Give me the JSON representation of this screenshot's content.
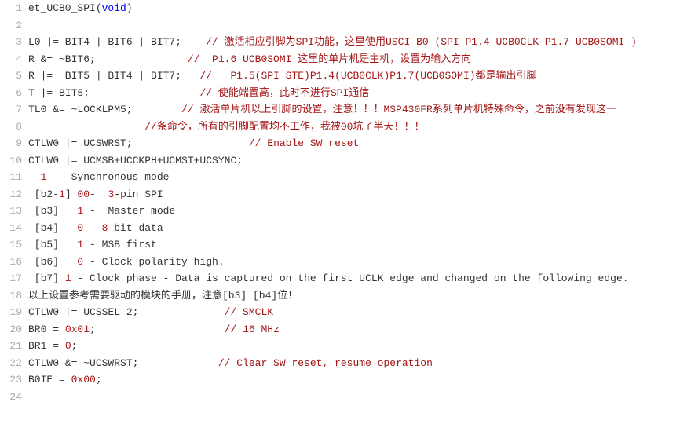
{
  "code": {
    "lines": [
      {
        "n": "1",
        "html": "et_UCB0_SPI(<span class='kw'>void</span>)"
      },
      {
        "n": "2",
        "html": ""
      },
      {
        "n": "3",
        "html": "L0 |= BIT4 | BIT6 | BIT7;    <span class='cm'>// 激活相应引脚为SPI功能，这里使用USCI_B0 (SPI P1.4 UCB0CLK P1.7 UCB0SOMI )</span>"
      },
      {
        "n": "4",
        "html": "R &amp;= ~BIT6;               <span class='cm'>//  P1.6 UCB0SOMI 这里的单片机是主机，设置为输入方向</span>"
      },
      {
        "n": "5",
        "html": "R |=  BIT5 | BIT4 | BIT7;   <span class='cm'>//   P1.5(SPI STE)P1.4(UCB0CLK)P1.7(UCB0SOMI)都是输出引脚</span>"
      },
      {
        "n": "6",
        "html": "T |= BIT5;                  <span class='cm'>// 使能端置高，此时不进行SPI通信</span>"
      },
      {
        "n": "7",
        "html": "TL0 &amp;= ~LOCKLPM5;        <span class='cm'>// 激活单片机以上引脚的设置，注意！！！MSP430FR系列单片机特殊命令，之前没有发现这一</span>"
      },
      {
        "n": "8",
        "html": "                   <span class='cm'>//条命令，所有的引脚配置均不工作，我被00坑了半天！！！</span>"
      },
      {
        "n": "9",
        "html": "CTLW0 |= UCSWRST;                   <span class='cm'>// Enable SW reset</span>"
      },
      {
        "n": "10",
        "html": "CTLW0 |= UCMSB+UCCKPH+UCMST+UCSYNC;"
      },
      {
        "n": "11",
        "html": "  <span class='num-red'>1</span> -  Synchronous mode"
      },
      {
        "n": "12",
        "html": " [b2-<span class='num-red'>1</span>] <span class='num-red'>00</span>-  <span class='num-red'>3</span>-pin SPI"
      },
      {
        "n": "13",
        "html": " [b3]   <span class='num-red'>1</span> -  Master mode"
      },
      {
        "n": "14",
        "html": " [b4]   <span class='num-red'>0</span> - <span class='num-red'>8</span>-bit data"
      },
      {
        "n": "15",
        "html": " [b5]   <span class='num-red'>1</span> - MSB first"
      },
      {
        "n": "16",
        "html": " [b6]   <span class='num-red'>0</span> - Clock polarity high."
      },
      {
        "n": "17",
        "html": " [b7] <span class='num-red'>1</span> - Clock phase - Data is captured on the first UCLK edge and changed on the following edge."
      },
      {
        "n": "18",
        "html": "以上设置参考需要驱动的模块的手册，注意[b3] [b4]位！"
      },
      {
        "n": "19",
        "html": "CTLW0 |= UCSSEL_2;              <span class='cm'>// SMCLK</span>"
      },
      {
        "n": "20",
        "html": "BR0 = <span class='num-red'>0x01</span>;                     <span class='cm'>// 16 MHz</span>"
      },
      {
        "n": "21",
        "html": "BR1 = <span class='num-red'>0</span>;"
      },
      {
        "n": "22",
        "html": "CTLW0 &amp;= ~UCSWRST;             <span class='cm'>// Clear SW reset, resume operation</span>"
      },
      {
        "n": "23",
        "html": "B0IE = <span class='num-red'>0x00</span>;"
      },
      {
        "n": "24",
        "html": ""
      }
    ]
  }
}
